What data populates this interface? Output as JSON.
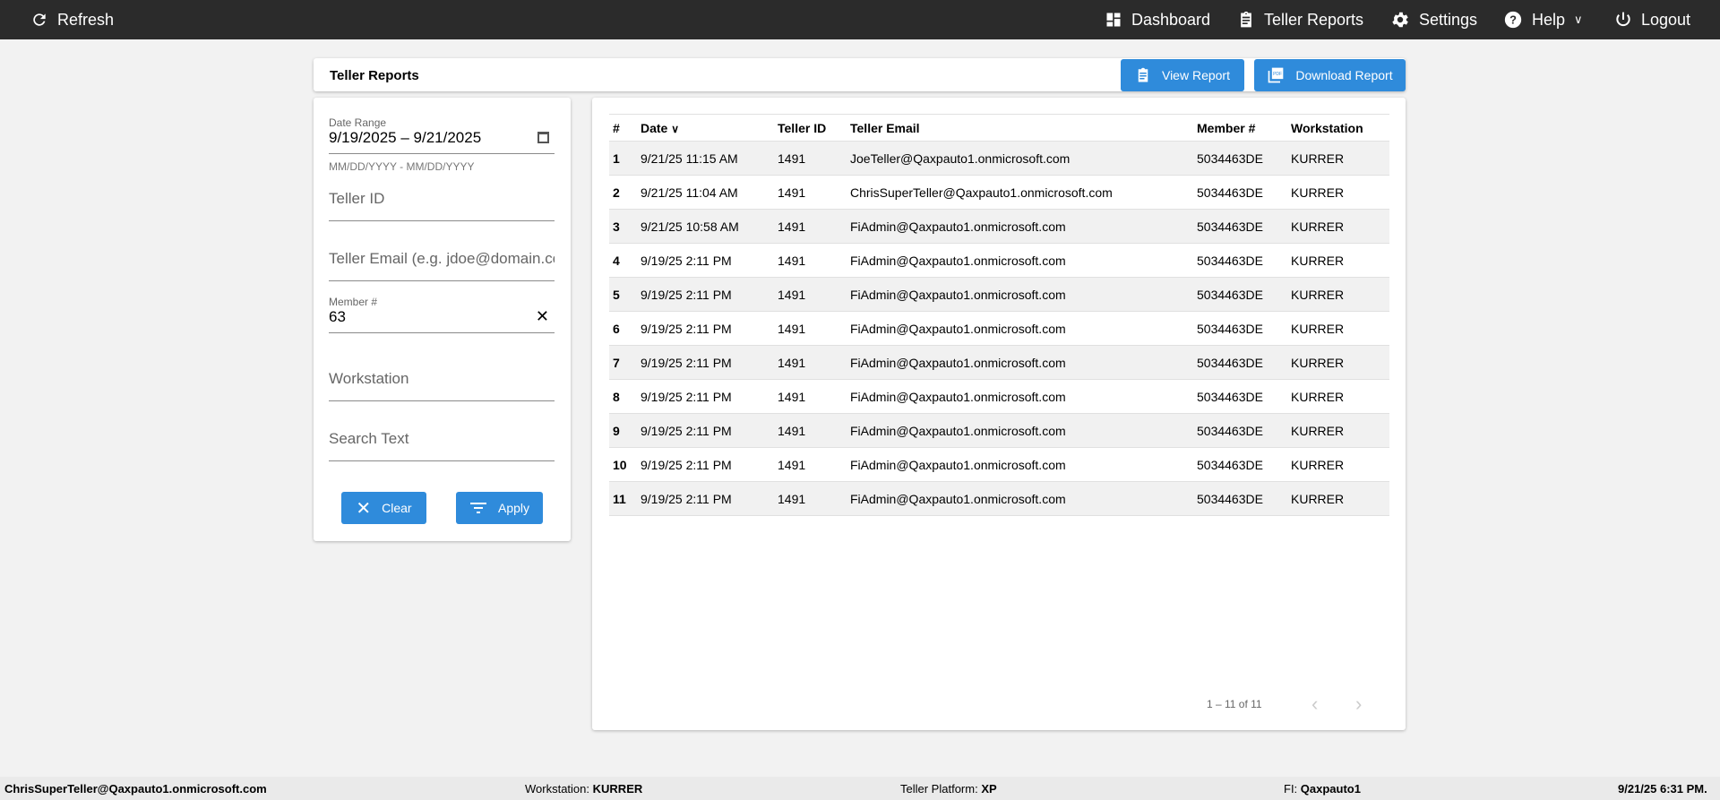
{
  "nav": {
    "refresh": "Refresh",
    "dashboard": "Dashboard",
    "teller_reports": "Teller Reports",
    "settings": "Settings",
    "help": "Help",
    "logout": "Logout"
  },
  "header": {
    "title": "Teller Reports",
    "view_report": "View Report",
    "download_report": "Download Report"
  },
  "filters": {
    "date_range_label": "Date Range",
    "date_range_value": "9/19/2025 – 9/21/2025",
    "date_hint": "MM/DD/YYYY - MM/DD/YYYY",
    "teller_id_placeholder": "Teller ID",
    "teller_email_placeholder": "Teller Email (e.g. jdoe@domain.com)",
    "member_label": "Member #",
    "member_value": "63",
    "workstation_placeholder": "Workstation",
    "search_placeholder": "Search Text",
    "clear": "Clear",
    "apply": "Apply"
  },
  "table": {
    "columns": [
      "#",
      "Date",
      "Teller ID",
      "Teller Email",
      "Member #",
      "Workstation"
    ],
    "sort_column": "Date",
    "sort_direction": "desc",
    "rows": [
      [
        "1",
        "9/21/25 11:15 AM",
        "1491",
        "JoeTeller@Qaxpauto1.onmicrosoft.com",
        "5034463DE",
        "KURRER"
      ],
      [
        "2",
        "9/21/25 11:04 AM",
        "1491",
        "ChrisSuperTeller@Qaxpauto1.onmicrosoft.com",
        "5034463DE",
        "KURRER"
      ],
      [
        "3",
        "9/21/25 10:58 AM",
        "1491",
        "FiAdmin@Qaxpauto1.onmicrosoft.com",
        "5034463DE",
        "KURRER"
      ],
      [
        "4",
        "9/19/25 2:11 PM",
        "1491",
        "FiAdmin@Qaxpauto1.onmicrosoft.com",
        "5034463DE",
        "KURRER"
      ],
      [
        "5",
        "9/19/25 2:11 PM",
        "1491",
        "FiAdmin@Qaxpauto1.onmicrosoft.com",
        "5034463DE",
        "KURRER"
      ],
      [
        "6",
        "9/19/25 2:11 PM",
        "1491",
        "FiAdmin@Qaxpauto1.onmicrosoft.com",
        "5034463DE",
        "KURRER"
      ],
      [
        "7",
        "9/19/25 2:11 PM",
        "1491",
        "FiAdmin@Qaxpauto1.onmicrosoft.com",
        "5034463DE",
        "KURRER"
      ],
      [
        "8",
        "9/19/25 2:11 PM",
        "1491",
        "FiAdmin@Qaxpauto1.onmicrosoft.com",
        "5034463DE",
        "KURRER"
      ],
      [
        "9",
        "9/19/25 2:11 PM",
        "1491",
        "FiAdmin@Qaxpauto1.onmicrosoft.com",
        "5034463DE",
        "KURRER"
      ],
      [
        "10",
        "9/19/25 2:11 PM",
        "1491",
        "FiAdmin@Qaxpauto1.onmicrosoft.com",
        "5034463DE",
        "KURRER"
      ],
      [
        "11",
        "9/19/25 2:11 PM",
        "1491",
        "FiAdmin@Qaxpauto1.onmicrosoft.com",
        "5034463DE",
        "KURRER"
      ]
    ],
    "pagination": "1 – 11 of 11"
  },
  "footer": {
    "user": "ChrisSuperTeller@Qaxpauto1.onmicrosoft.com",
    "workstation_label": "Workstation:",
    "workstation": "KURRER",
    "platform_label": "Teller Platform:",
    "platform": "XP",
    "fi_label": "FI:",
    "fi": "Qaxpauto1",
    "time": "9/21/25 6:31 PM."
  },
  "colors": {
    "nav_bg": "#2b2b2b",
    "accent": "#2f8bdb",
    "page_bg": "#f2f2f2"
  }
}
